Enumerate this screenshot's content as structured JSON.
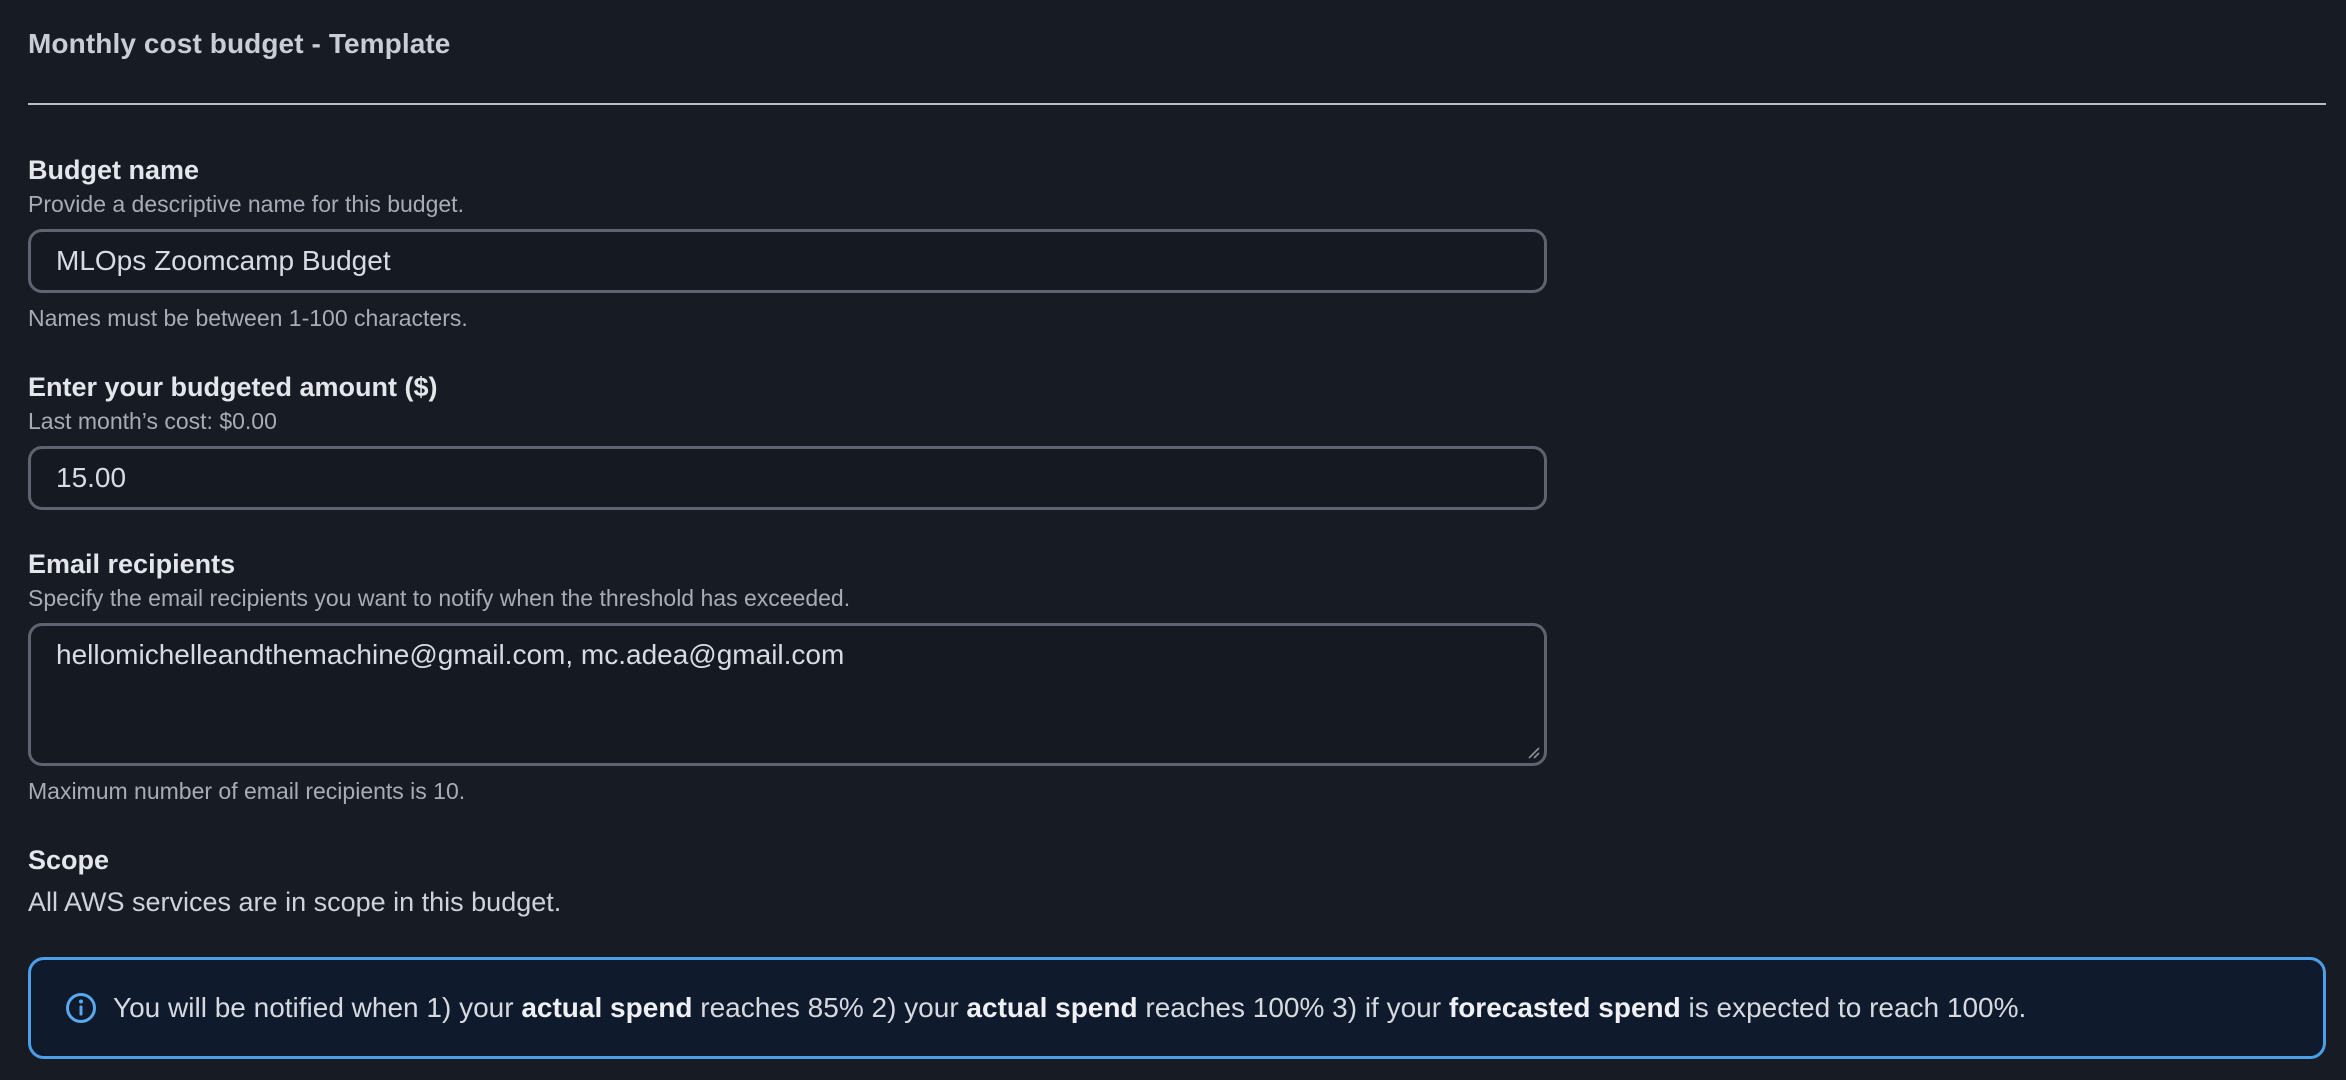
{
  "header": {
    "title": "Monthly cost budget - Template"
  },
  "budget_name": {
    "label": "Budget name",
    "description": "Provide a descriptive name for this budget.",
    "value": "MLOps Zoomcamp Budget",
    "hint": "Names must be between 1-100 characters."
  },
  "budget_amount": {
    "label": "Enter your budgeted amount ($)",
    "description": "Last month’s cost: $0.00",
    "value": "15.00"
  },
  "email_recipients": {
    "label": "Email recipients",
    "description": "Specify the email recipients you want to notify when the threshold has exceeded.",
    "value": "hellomichelleandthemachine@gmail.com, mc.adea@gmail.com",
    "hint": "Maximum number of email recipients is 10."
  },
  "scope": {
    "label": "Scope",
    "text": "All AWS services are in scope in this budget."
  },
  "info_alert": {
    "icon": "info-icon",
    "part1": "You will be notified when 1) your ",
    "bold1": "actual spend",
    "part2": " reaches 85% 2) your ",
    "bold2": "actual spend",
    "part3": " reaches 100% 3) if your ",
    "bold3": "forecasted spend",
    "part4": " is expected to reach 100%."
  },
  "colors": {
    "background": "#161b24",
    "info_border": "#4a9fe8",
    "info_background": "#0f1b2d",
    "input_border": "#5d6470"
  }
}
